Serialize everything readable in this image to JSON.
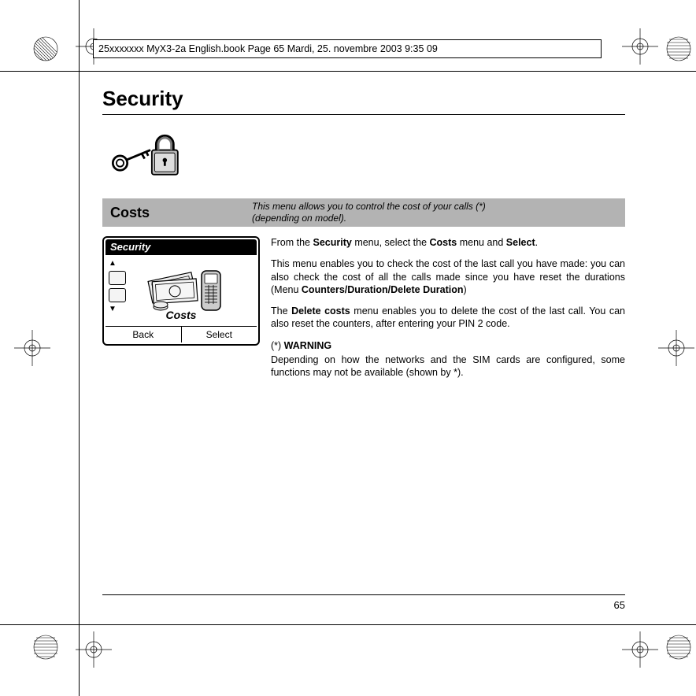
{
  "runner": "25xxxxxxx MyX3-2a English.book  Page 65  Mardi, 25. novembre 2003  9:35 09",
  "title": "Security",
  "section": {
    "title": "Costs",
    "desc_line1": "This menu allows you to control the cost of your calls (*)",
    "desc_line2": "(depending on model)."
  },
  "phone": {
    "title": "Security",
    "label": "Costs",
    "softkeys": {
      "left": "Back",
      "right": "Select"
    }
  },
  "body": {
    "p1_a": "From the ",
    "p1_b1": "Security",
    "p1_c": " menu, select the ",
    "p1_b2": "Costs",
    "p1_d": " menu and ",
    "p1_b3": "Select",
    "p1_e": ".",
    "p2_a": "This menu enables you to check the cost of the last call you have made: you can also check the cost of all the calls made since you have reset the durations (Menu ",
    "p2_b": "Counters/Duration/Delete Duration",
    "p2_c": ")",
    "p3_a": "The ",
    "p3_b": "Delete costs",
    "p3_c": " menu enables you to delete the cost of the last call. You can also reset the counters, after entering your PIN 2 code.",
    "p4_a": "(*) ",
    "p4_b": "WARNING",
    "p5": "Depending on how the networks and the SIM cards are configured, some functions may not be available (shown by *)."
  },
  "page_number": "65"
}
